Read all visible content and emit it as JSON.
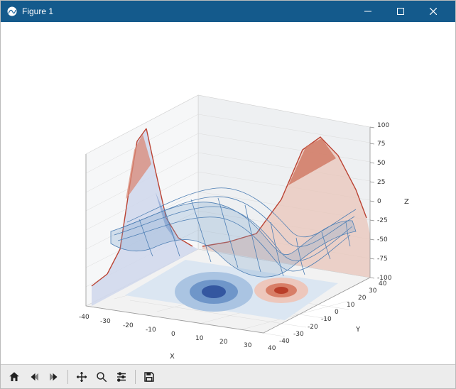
{
  "window": {
    "title": "Figure 1"
  },
  "toolbar": {
    "home": "Home",
    "back": "Back",
    "forward": "Forward",
    "pan": "Pan",
    "zoom": "Zoom",
    "configure": "Configure subplots",
    "save": "Save the figure"
  },
  "chart_data": {
    "type": "surface3d",
    "title": "",
    "x_axis": {
      "label": "X",
      "ticks": [
        -40,
        -30,
        -20,
        -10,
        0,
        10,
        20,
        30,
        40
      ],
      "range": [
        -40,
        40
      ]
    },
    "y_axis": {
      "label": "Y",
      "ticks": [
        -40,
        -30,
        -20,
        -10,
        0,
        10,
        20,
        30,
        40
      ],
      "range": [
        -40,
        40
      ]
    },
    "z_axis": {
      "label": "Z",
      "ticks": [
        -100,
        -75,
        -50,
        -25,
        0,
        25,
        50,
        75,
        100
      ],
      "range": [
        -100,
        100
      ]
    },
    "series": [
      {
        "name": "wireframe surface",
        "style": "wireframe",
        "color": "#3a72a8",
        "formula_hint": "two-gaussian-style peaks-valleys surface",
        "sample_points": [
          {
            "x": -20,
            "y": -20,
            "z": 10
          },
          {
            "x": -10,
            "y": -10,
            "z": 35
          },
          {
            "x": 0,
            "y": 0,
            "z": -60
          },
          {
            "x": 10,
            "y": 10,
            "z": -50
          },
          {
            "x": 20,
            "y": 20,
            "z": 15
          },
          {
            "x": 20,
            "y": -5,
            "z": 60
          },
          {
            "x": -30,
            "y": 0,
            "z": 5
          }
        ]
      },
      {
        "name": "contour (floor z=-100)",
        "style": "contourf",
        "colormap": "coolwarm",
        "levels_estimated": [
          -90,
          -60,
          -30,
          0,
          30,
          60,
          90
        ]
      },
      {
        "name": "profile on Y-max wall",
        "style": "filled_line",
        "colormap": "coolwarm",
        "values_vs_x_at_y_max": [
          0,
          5,
          20,
          70,
          95,
          55,
          10,
          -20,
          -5,
          0
        ]
      },
      {
        "name": "profile on X-min wall",
        "style": "filled_line",
        "colormap": "coolwarm",
        "values_vs_y_at_x_min": [
          0,
          -5,
          10,
          60,
          90,
          40,
          -30,
          -60,
          -10,
          0
        ]
      }
    ],
    "colors": {
      "wire": "#4e7fb4",
      "warm": "#d96c57",
      "cool": "#5078c8",
      "floor_bg": "#dbe6f2"
    }
  }
}
